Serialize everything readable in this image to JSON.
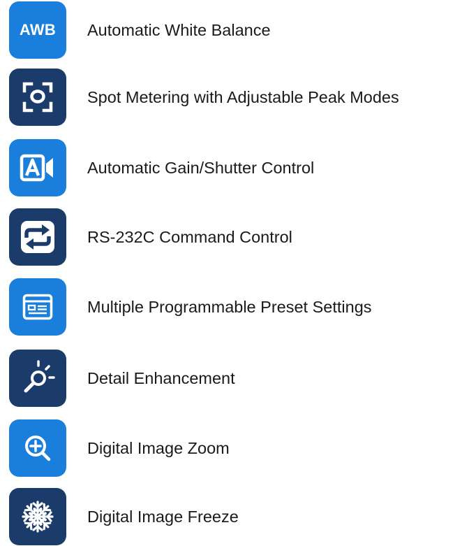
{
  "colors": {
    "light_blue": "#1a7fdc",
    "dark_blue": "#1b3c6b",
    "text": "#1a1a1a",
    "icon_fg": "#ffffff"
  },
  "features": [
    {
      "label": "Automatic White Balance",
      "icon": "awb-icon",
      "icon_text": "AWB",
      "tile": "light_blue"
    },
    {
      "label": "Spot Metering with Adjustable Peak Modes",
      "icon": "spot-metering-icon",
      "tile": "dark_blue"
    },
    {
      "label": "Automatic Gain/Shutter Control",
      "icon": "gain-shutter-icon",
      "tile": "light_blue"
    },
    {
      "label": "RS-232C Command Control",
      "icon": "command-control-icon",
      "tile": "dark_blue"
    },
    {
      "label": "Multiple Programmable Preset Settings",
      "icon": "preset-settings-icon",
      "tile": "light_blue"
    },
    {
      "label": "Detail Enhancement",
      "icon": "detail-enhancement-icon",
      "tile": "dark_blue"
    },
    {
      "label": "Digital Image Zoom",
      "icon": "zoom-icon",
      "tile": "light_blue"
    },
    {
      "label": "Digital Image Freeze",
      "icon": "freeze-icon",
      "tile": "dark_blue"
    }
  ]
}
